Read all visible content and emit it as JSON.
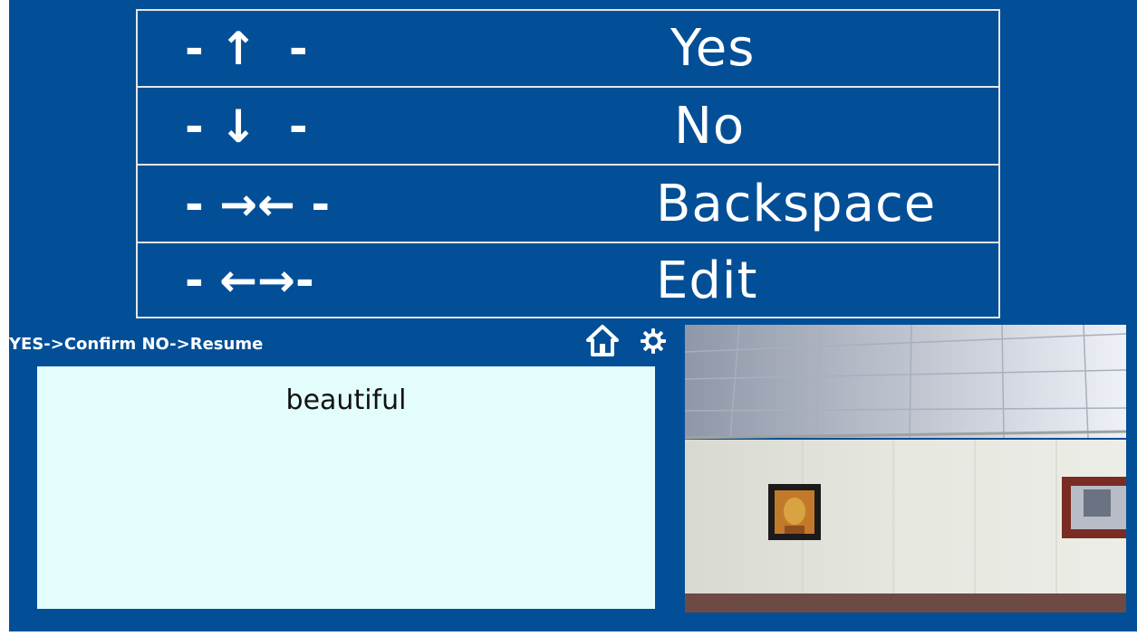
{
  "commands": [
    {
      "gesture": "- ↑  -",
      "label": "Yes"
    },
    {
      "gesture": "- ↓  -",
      "label": "No"
    },
    {
      "gesture": "- →← -",
      "label": "Backspace"
    },
    {
      "gesture": "- ←→-",
      "label": "Edit"
    }
  ],
  "hint": "YES->Confirm NO->Resume",
  "output_text": "beautiful",
  "icons": {
    "home": "home-icon",
    "settings": "gear-icon"
  },
  "colors": {
    "background": "#034f97",
    "panel": "#e3fdfc",
    "border": "#e6e6e6"
  }
}
